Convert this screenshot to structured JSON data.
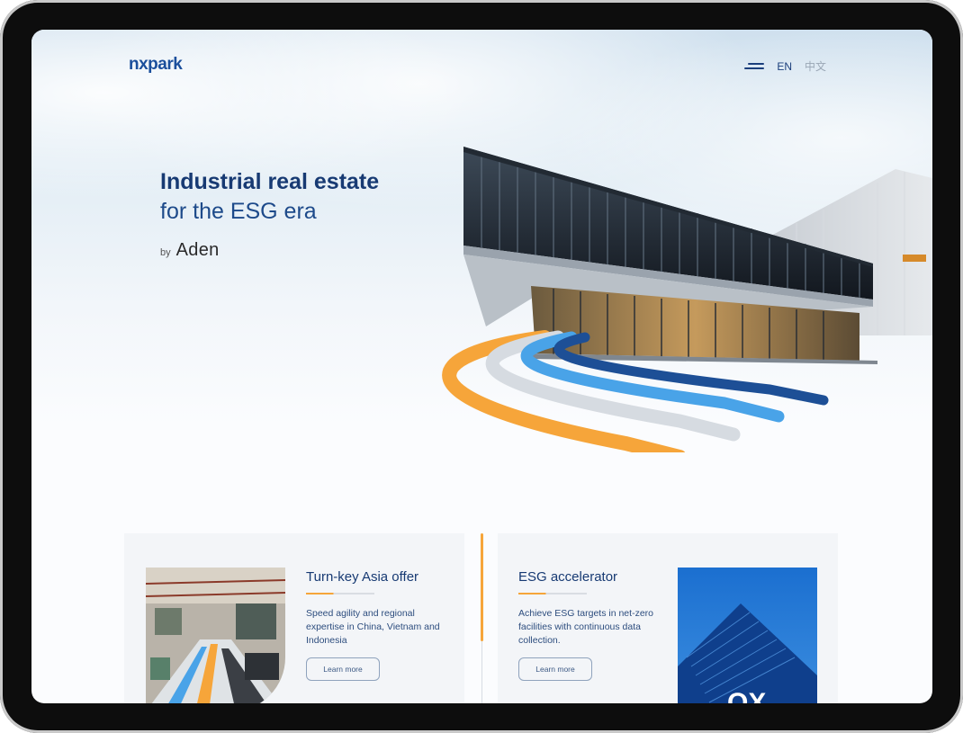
{
  "brand": {
    "logo_text": "nxpark"
  },
  "nav": {
    "lang_en": "EN",
    "lang_zh": "中文",
    "menu_icon": "hamburger-icon"
  },
  "hero": {
    "title_line1": "Industrial real estate",
    "title_line2": "for the ESG era",
    "by_label": "by",
    "by_brand": "Aden"
  },
  "cards": [
    {
      "title": "Turn-key Asia offer",
      "text": "Speed agility and regional expertise in China, Vietnam and Indonesia",
      "button": "Learn more"
    },
    {
      "title": "ESG accelerator",
      "text": "Achieve ESG targets in net-zero facilities with continuous data collection.",
      "button": "Learn more"
    }
  ],
  "colors": {
    "brand_blue": "#173a73",
    "accent_orange": "#f6a53a",
    "light_blue": "#49a3e8",
    "grey": "#d6dbe1",
    "navy": "#1b3f7c"
  }
}
